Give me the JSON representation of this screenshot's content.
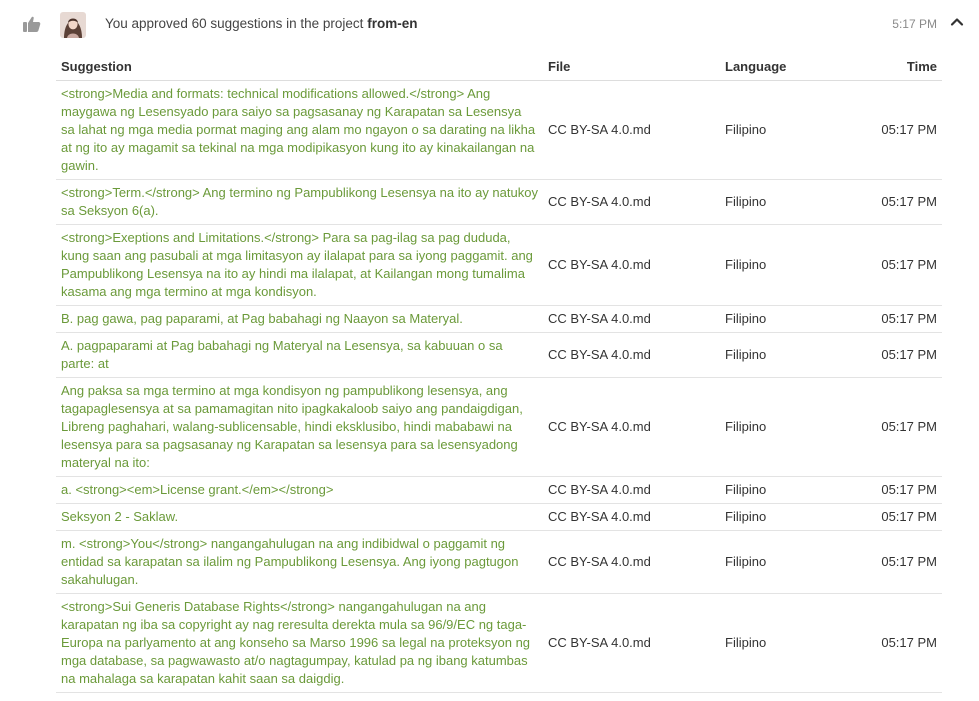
{
  "header": {
    "prefix": "You approved 60 suggestions in the project",
    "project": "from-en",
    "time": "5:17 PM"
  },
  "icons": {
    "status": "thumbs-up-icon",
    "collapse": "chevron-up-icon",
    "avatar": "user-avatar"
  },
  "colors": {
    "suggestion_text": "#6b9a3a",
    "icon_gray": "#9a9a9a"
  },
  "table": {
    "columns": [
      "Suggestion",
      "File",
      "Language",
      "Time"
    ],
    "rows": [
      {
        "suggestion": "<strong>Media and formats: technical modifications allowed.</strong> Ang maygawa ng Lesensyado para saiyo sa pagsasanay ng Karapatan sa Lesensya sa lahat ng mga media pormat maging ang alam mo ngayon o sa darating na likha at ng ito ay magamit sa tekinal na mga modipikasyon kung ito ay kinakailangan na gawin.",
        "file": "CC BY-SA 4.0.md",
        "language": "Filipino",
        "time": "05:17 PM"
      },
      {
        "suggestion": "<strong>Term.</strong> Ang termino ng Pampublikong Lesensya na ito ay natukoy sa Seksyon 6(a).",
        "file": "CC BY-SA 4.0.md",
        "language": "Filipino",
        "time": "05:17 PM"
      },
      {
        "suggestion": "<strong>Exeptions and Limitations.</strong> Para sa pag-ilag sa pag dududa, kung saan ang pasubali at mga limitasyon ay ilalapat para sa iyong paggamit. ang Pampublikong Lesensya na ito ay hindi ma ilalapat, at Kailangan mong tumalima kasama ang mga termino at mga kondisyon.",
        "file": "CC BY-SA 4.0.md",
        "language": "Filipino",
        "time": "05:17 PM"
      },
      {
        "suggestion": "B. pag gawa, pag paparami, at Pag babahagi ng Naayon sa Materyal.",
        "file": "CC BY-SA 4.0.md",
        "language": "Filipino",
        "time": "05:17 PM"
      },
      {
        "suggestion": "A. pagpaparami at Pag babahagi ng Materyal na Lesensya, sa kabuuan o sa parte: at",
        "file": "CC BY-SA 4.0.md",
        "language": "Filipino",
        "time": "05:17 PM"
      },
      {
        "suggestion": "Ang paksa sa mga termino at mga kondisyon ng pampublikong lesensya, ang tagapaglesensya at sa pamamagitan nito ipagkakaloob saiyo ang pandaigdigan, Libreng paghahari, walang-sublicensable, hindi eksklusibo, hindi mababawi na lesensya para sa pagsasanay ng Karapatan sa lesensya para sa lesensyadong materyal na ito:",
        "file": "CC BY-SA 4.0.md",
        "language": "Filipino",
        "time": "05:17 PM"
      },
      {
        "suggestion": "a. <strong><em>License grant.</em></strong>",
        "file": "CC BY-SA 4.0.md",
        "language": "Filipino",
        "time": "05:17 PM"
      },
      {
        "suggestion": "Seksyon 2 - Saklaw.",
        "file": "CC BY-SA 4.0.md",
        "language": "Filipino",
        "time": "05:17 PM"
      },
      {
        "suggestion": "m. <strong>You</strong> nangangahulugan na ang indibidwal o paggamit ng entidad sa karapatan sa ilalim ng Pampublikong Lesensya. Ang iyong pagtugon sakahulugan.",
        "file": "CC BY-SA 4.0.md",
        "language": "Filipino",
        "time": "05:17 PM"
      },
      {
        "suggestion": "<strong>Sui Generis Database Rights</strong> nangangahulugan na ang karapatan ng iba sa copyright ay nag reresulta derekta mula sa 96/9/EC ng taga-Europa na parlyamento at ang konseho sa Marso 1996 sa legal na proteksyon ng mga database, sa pagwawasto at/o nagtagumpay, katulad pa ng ibang katumbas na mahalaga sa karapatan kahit saan sa daigdig.",
        "file": "CC BY-SA 4.0.md",
        "language": "Filipino",
        "time": "05:17 PM"
      }
    ]
  }
}
